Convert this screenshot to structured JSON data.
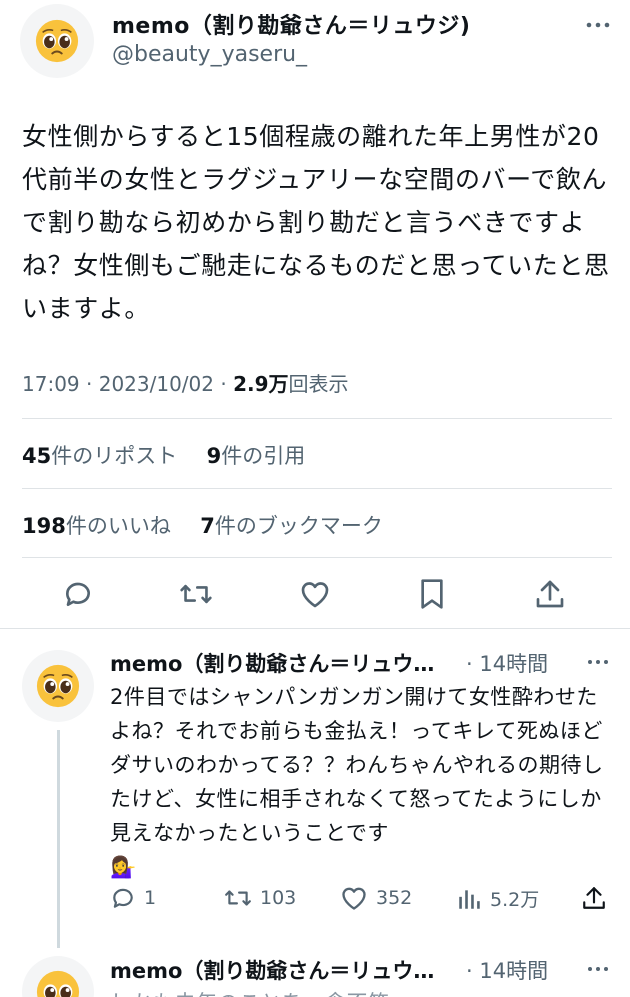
{
  "main_tweet": {
    "display_name": "memo（割り勘爺さん＝リュウジ)",
    "handle": "@beauty_yaseru_",
    "text": "女性側からすると15個程歳の離れた年上男性が20代前半の女性とラグジュアリーな空間のバーで飲んで割り勘なら初めから割り勘だと言うべきですよね？女性側もご馳走になるものだと思っていたと思いますよ。",
    "time": "17:09",
    "date": "2023/10/02",
    "views_count": "2.9万",
    "views_label": "回表示",
    "reposts_count": "45",
    "reposts_label": "件のリポスト",
    "quotes_count": "9",
    "quotes_label": "件の引用",
    "likes_count": "198",
    "likes_label": "件のいいね",
    "bookmarks_count": "7",
    "bookmarks_label": "件のブックマーク"
  },
  "reply_1": {
    "display_name": "memo（割り勘爺さん＝リュウ…",
    "time_ago": "14時間",
    "text": "2件目ではシャンパンガンガン開けて女性酔わせたよね？それでお前らも金払え！ってキレて死ぬほどダサいのわかってる？？わんちゃんやれるの期待したけど、女性に相手されなくて怒ってたようにしか見えなかったということです",
    "emoji": "💁‍♀️",
    "replies": "1",
    "retweets": "103",
    "likes": "352",
    "views": "5.2万"
  },
  "reply_2": {
    "display_name": "memo（割り勘爺さん＝リュウ…",
    "time_ago": "14時間",
    "text_partial": "しかも去年のことを一念不笑"
  },
  "icons": {
    "avatar": "pleading-face-emoji",
    "more": "more-horizontal-icon",
    "reply": "reply-bubble-icon",
    "retweet": "retweet-icon",
    "like": "heart-icon",
    "bookmark": "bookmark-icon",
    "share": "share-icon",
    "views": "bar-chart-icon"
  },
  "colors": {
    "text": "#0f1419",
    "muted": "#536471",
    "divider": "#dfe3e6"
  }
}
